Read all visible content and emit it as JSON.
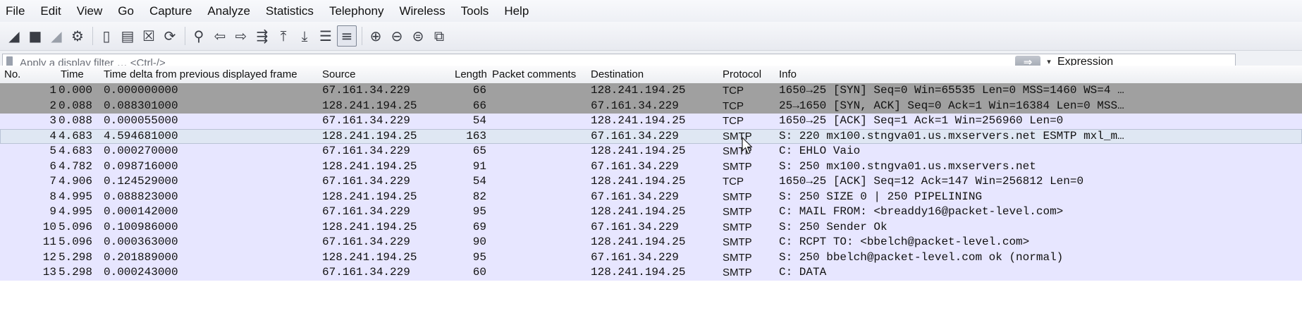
{
  "menu": [
    "File",
    "Edit",
    "View",
    "Go",
    "Capture",
    "Analyze",
    "Statistics",
    "Telephony",
    "Wireless",
    "Tools",
    "Help"
  ],
  "toolbar": [
    {
      "name": "shark-fin-start-icon",
      "glyph": "◢",
      "dim": false
    },
    {
      "name": "stop-capture-icon",
      "glyph": "■",
      "dim": false
    },
    {
      "name": "restart-capture-icon",
      "glyph": "◢",
      "dim": true
    },
    {
      "name": "capture-options-icon",
      "glyph": "⚙",
      "dim": false
    },
    {
      "sep": true
    },
    {
      "name": "open-file-icon",
      "glyph": "▯",
      "dim": false
    },
    {
      "name": "save-file-icon",
      "glyph": "▤",
      "dim": false
    },
    {
      "name": "close-file-icon",
      "glyph": "☒",
      "dim": false
    },
    {
      "name": "reload-file-icon",
      "glyph": "⟳",
      "dim": false
    },
    {
      "sep": true
    },
    {
      "name": "find-packet-icon",
      "glyph": "⚲",
      "dim": false
    },
    {
      "name": "go-back-icon",
      "glyph": "⇦",
      "dim": false
    },
    {
      "name": "go-forward-icon",
      "glyph": "⇨",
      "dim": false
    },
    {
      "name": "go-to-packet-icon",
      "glyph": "⇶",
      "dim": false
    },
    {
      "name": "go-first-packet-icon",
      "glyph": "⤒",
      "dim": false
    },
    {
      "name": "go-last-packet-icon",
      "glyph": "⤓",
      "dim": false
    },
    {
      "name": "auto-scroll-icon",
      "glyph": "☰",
      "dim": false
    },
    {
      "name": "colorize-icon",
      "glyph": "≡",
      "dim": false,
      "active": true
    },
    {
      "sep": true
    },
    {
      "name": "zoom-in-icon",
      "glyph": "⊕",
      "dim": false
    },
    {
      "name": "zoom-out-icon",
      "glyph": "⊖",
      "dim": false
    },
    {
      "name": "zoom-normal-icon",
      "glyph": "⊜",
      "dim": false
    },
    {
      "name": "resize-columns-icon",
      "glyph": "⧉",
      "dim": false
    }
  ],
  "filter": {
    "placeholder": "Apply a display filter … <Ctrl-/>",
    "apply_arrow": "⇒",
    "dropdown": "▾",
    "expression_label": "Expression"
  },
  "columns": [
    "No.",
    "Time",
    "Time delta from previous displayed frame",
    "Source",
    "Length",
    "Packet comments",
    "Destination",
    "Protocol",
    "Info"
  ],
  "packets": [
    {
      "no": "1",
      "time": "0.000",
      "delta": "0.000000000",
      "src": "67.161.34.229",
      "len": "66",
      "comment": "",
      "dst": "128.241.194.25",
      "proto": "TCP",
      "info": "1650→25 [SYN] Seq=0 Win=65535 Len=0 MSS=1460 WS=4 …",
      "style": "syn"
    },
    {
      "no": "2",
      "time": "0.088",
      "delta": "0.088301000",
      "src": "128.241.194.25",
      "len": "66",
      "comment": "",
      "dst": "67.161.34.229",
      "proto": "TCP",
      "info": "25→1650 [SYN, ACK] Seq=0 Ack=1 Win=16384 Len=0 MSS…",
      "style": "syn"
    },
    {
      "no": "3",
      "time": "0.088",
      "delta": "0.000055000",
      "src": "67.161.34.229",
      "len": "54",
      "comment": "",
      "dst": "128.241.194.25",
      "proto": "TCP",
      "info": "1650→25 [ACK] Seq=1 Ack=1 Win=256960 Len=0",
      "style": "tcp"
    },
    {
      "no": "4",
      "time": "4.683",
      "delta": "4.594681000",
      "src": "128.241.194.25",
      "len": "163",
      "comment": "",
      "dst": "67.161.34.229",
      "proto": "SMTP",
      "info": "S: 220 mx100.stngva01.us.mxservers.net ESMTP mxl_m…",
      "style": "selected"
    },
    {
      "no": "5",
      "time": "4.683",
      "delta": "0.000270000",
      "src": "67.161.34.229",
      "len": "65",
      "comment": "",
      "dst": "128.241.194.25",
      "proto": "SMTP",
      "info": "C: EHLO Vaio",
      "style": "smtp"
    },
    {
      "no": "6",
      "time": "4.782",
      "delta": "0.098716000",
      "src": "128.241.194.25",
      "len": "91",
      "comment": "",
      "dst": "67.161.34.229",
      "proto": "SMTP",
      "info": "S: 250 mx100.stngva01.us.mxservers.net",
      "style": "smtp"
    },
    {
      "no": "7",
      "time": "4.906",
      "delta": "0.124529000",
      "src": "67.161.34.229",
      "len": "54",
      "comment": "",
      "dst": "128.241.194.25",
      "proto": "TCP",
      "info": "1650→25 [ACK] Seq=12 Ack=147 Win=256812 Len=0",
      "style": "tcp"
    },
    {
      "no": "8",
      "time": "4.995",
      "delta": "0.088823000",
      "src": "128.241.194.25",
      "len": "82",
      "comment": "",
      "dst": "67.161.34.229",
      "proto": "SMTP",
      "info": "S: 250 SIZE 0 | 250 PIPELINING",
      "style": "smtp"
    },
    {
      "no": "9",
      "time": "4.995",
      "delta": "0.000142000",
      "src": "67.161.34.229",
      "len": "95",
      "comment": "",
      "dst": "128.241.194.25",
      "proto": "SMTP",
      "info": "C: MAIL FROM: <breaddy16@packet-level.com>",
      "style": "smtp"
    },
    {
      "no": "10",
      "time": "5.096",
      "delta": "0.100986000",
      "src": "128.241.194.25",
      "len": "69",
      "comment": "",
      "dst": "67.161.34.229",
      "proto": "SMTP",
      "info": "S: 250 Sender Ok",
      "style": "smtp"
    },
    {
      "no": "11",
      "time": "5.096",
      "delta": "0.000363000",
      "src": "67.161.34.229",
      "len": "90",
      "comment": "",
      "dst": "128.241.194.25",
      "proto": "SMTP",
      "info": "C: RCPT TO: <bbelch@packet-level.com>",
      "style": "smtp"
    },
    {
      "no": "12",
      "time": "5.298",
      "delta": "0.201889000",
      "src": "128.241.194.25",
      "len": "95",
      "comment": "",
      "dst": "67.161.34.229",
      "proto": "SMTP",
      "info": "S: 250 bbelch@packet-level.com ok (normal)",
      "style": "smtp"
    },
    {
      "no": "13",
      "time": "5.298",
      "delta": "0.000243000",
      "src": "67.161.34.229",
      "len": "60",
      "comment": "",
      "dst": "128.241.194.25",
      "proto": "SMTP",
      "info": "C: DATA",
      "style": "smtp"
    }
  ]
}
